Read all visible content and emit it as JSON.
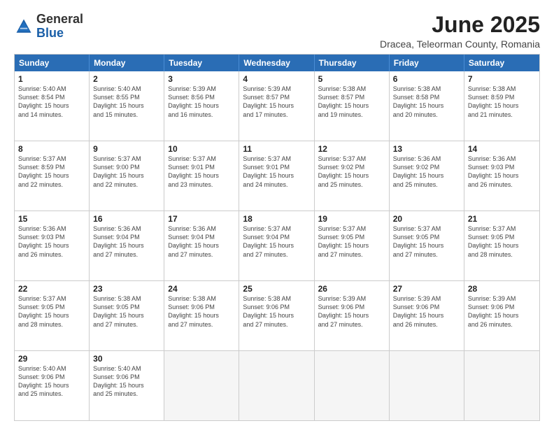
{
  "logo": {
    "general": "General",
    "blue": "Blue"
  },
  "title": {
    "month": "June 2025",
    "location": "Dracea, Teleorman County, Romania"
  },
  "header_days": [
    "Sunday",
    "Monday",
    "Tuesday",
    "Wednesday",
    "Thursday",
    "Friday",
    "Saturday"
  ],
  "weeks": [
    [
      {
        "day": "1",
        "lines": [
          "Sunrise: 5:40 AM",
          "Sunset: 8:54 PM",
          "Daylight: 15 hours",
          "and 14 minutes."
        ]
      },
      {
        "day": "2",
        "lines": [
          "Sunrise: 5:40 AM",
          "Sunset: 8:55 PM",
          "Daylight: 15 hours",
          "and 15 minutes."
        ]
      },
      {
        "day": "3",
        "lines": [
          "Sunrise: 5:39 AM",
          "Sunset: 8:56 PM",
          "Daylight: 15 hours",
          "and 16 minutes."
        ]
      },
      {
        "day": "4",
        "lines": [
          "Sunrise: 5:39 AM",
          "Sunset: 8:57 PM",
          "Daylight: 15 hours",
          "and 17 minutes."
        ]
      },
      {
        "day": "5",
        "lines": [
          "Sunrise: 5:38 AM",
          "Sunset: 8:57 PM",
          "Daylight: 15 hours",
          "and 19 minutes."
        ]
      },
      {
        "day": "6",
        "lines": [
          "Sunrise: 5:38 AM",
          "Sunset: 8:58 PM",
          "Daylight: 15 hours",
          "and 20 minutes."
        ]
      },
      {
        "day": "7",
        "lines": [
          "Sunrise: 5:38 AM",
          "Sunset: 8:59 PM",
          "Daylight: 15 hours",
          "and 21 minutes."
        ]
      }
    ],
    [
      {
        "day": "8",
        "lines": [
          "Sunrise: 5:37 AM",
          "Sunset: 8:59 PM",
          "Daylight: 15 hours",
          "and 22 minutes."
        ]
      },
      {
        "day": "9",
        "lines": [
          "Sunrise: 5:37 AM",
          "Sunset: 9:00 PM",
          "Daylight: 15 hours",
          "and 22 minutes."
        ]
      },
      {
        "day": "10",
        "lines": [
          "Sunrise: 5:37 AM",
          "Sunset: 9:01 PM",
          "Daylight: 15 hours",
          "and 23 minutes."
        ]
      },
      {
        "day": "11",
        "lines": [
          "Sunrise: 5:37 AM",
          "Sunset: 9:01 PM",
          "Daylight: 15 hours",
          "and 24 minutes."
        ]
      },
      {
        "day": "12",
        "lines": [
          "Sunrise: 5:37 AM",
          "Sunset: 9:02 PM",
          "Daylight: 15 hours",
          "and 25 minutes."
        ]
      },
      {
        "day": "13",
        "lines": [
          "Sunrise: 5:36 AM",
          "Sunset: 9:02 PM",
          "Daylight: 15 hours",
          "and 25 minutes."
        ]
      },
      {
        "day": "14",
        "lines": [
          "Sunrise: 5:36 AM",
          "Sunset: 9:03 PM",
          "Daylight: 15 hours",
          "and 26 minutes."
        ]
      }
    ],
    [
      {
        "day": "15",
        "lines": [
          "Sunrise: 5:36 AM",
          "Sunset: 9:03 PM",
          "Daylight: 15 hours",
          "and 26 minutes."
        ]
      },
      {
        "day": "16",
        "lines": [
          "Sunrise: 5:36 AM",
          "Sunset: 9:04 PM",
          "Daylight: 15 hours",
          "and 27 minutes."
        ]
      },
      {
        "day": "17",
        "lines": [
          "Sunrise: 5:36 AM",
          "Sunset: 9:04 PM",
          "Daylight: 15 hours",
          "and 27 minutes."
        ]
      },
      {
        "day": "18",
        "lines": [
          "Sunrise: 5:37 AM",
          "Sunset: 9:04 PM",
          "Daylight: 15 hours",
          "and 27 minutes."
        ]
      },
      {
        "day": "19",
        "lines": [
          "Sunrise: 5:37 AM",
          "Sunset: 9:05 PM",
          "Daylight: 15 hours",
          "and 27 minutes."
        ]
      },
      {
        "day": "20",
        "lines": [
          "Sunrise: 5:37 AM",
          "Sunset: 9:05 PM",
          "Daylight: 15 hours",
          "and 27 minutes."
        ]
      },
      {
        "day": "21",
        "lines": [
          "Sunrise: 5:37 AM",
          "Sunset: 9:05 PM",
          "Daylight: 15 hours",
          "and 28 minutes."
        ]
      }
    ],
    [
      {
        "day": "22",
        "lines": [
          "Sunrise: 5:37 AM",
          "Sunset: 9:05 PM",
          "Daylight: 15 hours",
          "and 28 minutes."
        ]
      },
      {
        "day": "23",
        "lines": [
          "Sunrise: 5:38 AM",
          "Sunset: 9:05 PM",
          "Daylight: 15 hours",
          "and 27 minutes."
        ]
      },
      {
        "day": "24",
        "lines": [
          "Sunrise: 5:38 AM",
          "Sunset: 9:06 PM",
          "Daylight: 15 hours",
          "and 27 minutes."
        ]
      },
      {
        "day": "25",
        "lines": [
          "Sunrise: 5:38 AM",
          "Sunset: 9:06 PM",
          "Daylight: 15 hours",
          "and 27 minutes."
        ]
      },
      {
        "day": "26",
        "lines": [
          "Sunrise: 5:39 AM",
          "Sunset: 9:06 PM",
          "Daylight: 15 hours",
          "and 27 minutes."
        ]
      },
      {
        "day": "27",
        "lines": [
          "Sunrise: 5:39 AM",
          "Sunset: 9:06 PM",
          "Daylight: 15 hours",
          "and 26 minutes."
        ]
      },
      {
        "day": "28",
        "lines": [
          "Sunrise: 5:39 AM",
          "Sunset: 9:06 PM",
          "Daylight: 15 hours",
          "and 26 minutes."
        ]
      }
    ],
    [
      {
        "day": "29",
        "lines": [
          "Sunrise: 5:40 AM",
          "Sunset: 9:06 PM",
          "Daylight: 15 hours",
          "and 25 minutes."
        ]
      },
      {
        "day": "30",
        "lines": [
          "Sunrise: 5:40 AM",
          "Sunset: 9:06 PM",
          "Daylight: 15 hours",
          "and 25 minutes."
        ]
      },
      {
        "day": "",
        "lines": []
      },
      {
        "day": "",
        "lines": []
      },
      {
        "day": "",
        "lines": []
      },
      {
        "day": "",
        "lines": []
      },
      {
        "day": "",
        "lines": []
      }
    ]
  ]
}
